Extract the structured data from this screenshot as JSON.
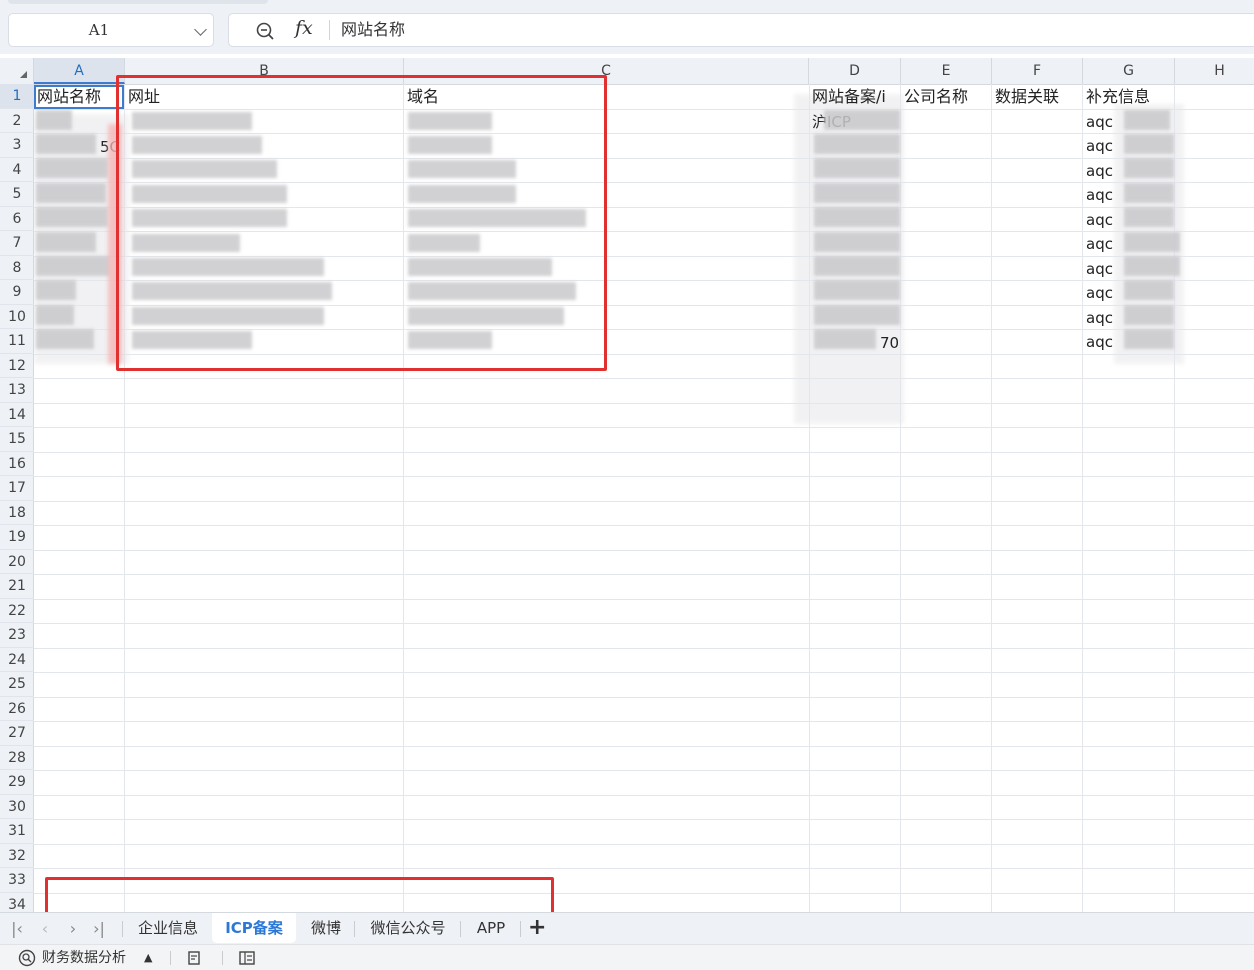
{
  "formula_bar": {
    "cell_ref": "A1",
    "fx_label": "fx",
    "content": "网站名称"
  },
  "columns": [
    "A",
    "B",
    "C",
    "D",
    "E",
    "F",
    "G",
    "H"
  ],
  "rows": [
    "1",
    "2",
    "3",
    "4",
    "5",
    "6",
    "7",
    "8",
    "9",
    "10",
    "11",
    "12",
    "13",
    "14",
    "15",
    "16",
    "17",
    "18",
    "19",
    "20",
    "21",
    "22",
    "23",
    "24",
    "25",
    "26",
    "27",
    "28",
    "29",
    "30",
    "31",
    "32",
    "33",
    "34"
  ],
  "header_row": {
    "A": "网站名称",
    "B": "网址",
    "C": "域名",
    "D": "网站备案/i",
    "E": "公司名称",
    "F": "数据关联",
    "G": "补充信息"
  },
  "visible_fragments": {
    "d2": "沪ICP",
    "d11": "70",
    "g_prefix": "aqc",
    "a3_tail": "5C"
  },
  "sheet_tabs": {
    "tabs": [
      "企业信息",
      "ICP备案",
      "微博",
      "微信公众号",
      "APP"
    ],
    "active": "ICP备案",
    "add_label": "+"
  },
  "status_bar": {
    "analysis_label": "财务数据分析"
  },
  "colors": {
    "accent": "#2d78d6",
    "annotation": "#e03030",
    "header_bg": "#eef1f6"
  }
}
